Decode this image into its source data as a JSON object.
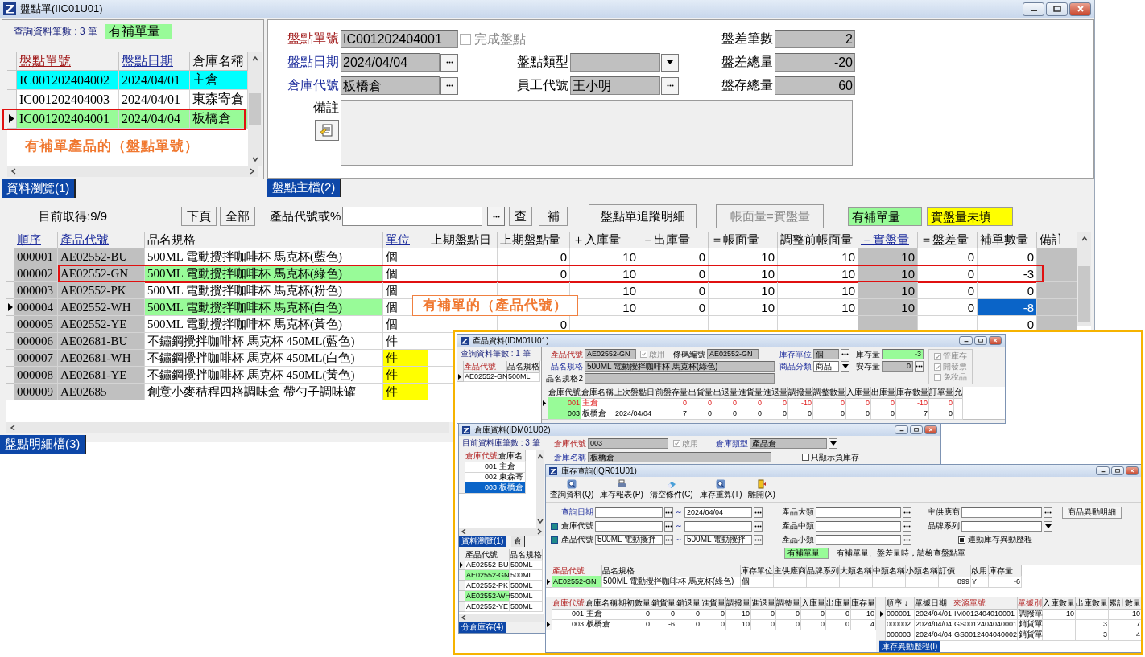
{
  "window": {
    "title": "盤點單(IIC01U01)"
  },
  "browse": {
    "count_text": "查詢資料筆數 : 3 筆",
    "legend": {
      "label": "有補單量",
      "color": "#98fb98"
    },
    "columns": [
      "盤點單號",
      "盤點日期",
      "倉庫名稱"
    ],
    "rows": [
      {
        "cells": [
          "IC001202404002",
          "2024/04/01",
          "主倉"
        ],
        "color": "#00ffff",
        "current": false,
        "annotated": false
      },
      {
        "cells": [
          "IC001202404003",
          "2024/04/01",
          "東森寄倉"
        ],
        "color": "#ffffff",
        "current": false,
        "annotated": false
      },
      {
        "cells": [
          "IC001202404001",
          "2024/04/04",
          "板橋倉"
        ],
        "color": "#98fb98",
        "current": true,
        "annotated": true
      }
    ],
    "annotation": "有補單產品的（盤點單號）",
    "tab": {
      "label": "資料瀏覽(1)",
      "selected": true
    }
  },
  "master": {
    "rows": [
      [
        {
          "kind": "text",
          "label": "盤點單號",
          "value": "IC001202404001"
        },
        {
          "kind": "checkbox",
          "label": "完成盤點",
          "checked": false,
          "disabled": true
        },
        {
          "kind": "number",
          "label": "盤差筆數",
          "value": "2"
        }
      ],
      [
        {
          "kind": "lookup",
          "label": "盤點日期",
          "value": "2024/04/04"
        },
        {
          "kind": "dropdown",
          "label": "盤點類型"
        },
        {
          "kind": "number",
          "label": "盤差總量",
          "value": "-20"
        }
      ],
      [
        {
          "kind": "lookup",
          "label": "倉庫代號",
          "value": "板橋倉"
        },
        {
          "kind": "lookup",
          "label": "員工代號",
          "value": "王小明"
        },
        {
          "kind": "number",
          "label": "盤存總量",
          "value": "60"
        }
      ]
    ],
    "remark_label": "備註",
    "tab": {
      "label": "盤點主檔(2)",
      "selected": true
    }
  },
  "detail": {
    "fetched": "目前取得:9/9",
    "page_buttons": [
      "下頁",
      "全部"
    ],
    "search_label": "產品代號或%",
    "query_button": "查",
    "supplement_button": "補",
    "trace_button": "盤點單追蹤明細",
    "sync_button": {
      "label": "帳面量=實盤量",
      "disabled": true
    },
    "legends": [
      {
        "label": "有補單量",
        "color": "#98fb98"
      },
      {
        "label": "實盤量未填",
        "color": "#ffff00"
      }
    ],
    "columns": [
      "順序",
      "產品代號",
      "品名規格",
      "單位",
      "上期盤點日",
      "上期盤點量",
      "＋入庫量",
      "－出庫量",
      "＝帳面量",
      "調整前帳面量",
      "－實盤量",
      "＝盤差量",
      "補單數量",
      "備註"
    ],
    "rows": [
      {
        "seq": "000001",
        "code": "AE02552-BU",
        "name": "500ML 電動攪拌咖啡杯 馬克杯(藍色)",
        "unit": "個",
        "values": {
          "prev_qty": "0",
          "in_qty": "10",
          "out_qty": "0",
          "book_qty": "10",
          "pre_adjust_qty": "10",
          "counted_qty": "10",
          "diff_qty": "0",
          "supplement_qty": "0"
        },
        "has_supplement": false,
        "count_missing": false,
        "current": false,
        "cell_selected": false,
        "annotated": false
      },
      {
        "seq": "000002",
        "code": "AE02552-GN",
        "name": "500ML 電動攪拌咖啡杯 馬克杯(綠色)",
        "unit": "個",
        "values": {
          "prev_qty": "0",
          "in_qty": "10",
          "out_qty": "0",
          "book_qty": "10",
          "pre_adjust_qty": "10",
          "counted_qty": "10",
          "diff_qty": "0",
          "supplement_qty": "-3"
        },
        "has_supplement": true,
        "count_missing": false,
        "current": false,
        "cell_selected": false,
        "annotated": true
      },
      {
        "seq": "000003",
        "code": "AE02552-PK",
        "name": "500ML 電動攪拌咖啡杯 馬克杯(粉色)",
        "unit": "個",
        "values": {
          "in_qty": "10",
          "out_qty": "0",
          "book_qty": "10",
          "pre_adjust_qty": "10",
          "counted_qty": "10",
          "diff_qty": "0",
          "supplement_qty": "0"
        },
        "has_supplement": false,
        "count_missing": false,
        "current": false,
        "cell_selected": false,
        "annotated": false
      },
      {
        "seq": "000004",
        "code": "AE02552-WH",
        "name": "500ML 電動攪拌咖啡杯 馬克杯(白色)",
        "unit": "個",
        "values": {
          "in_qty": "10",
          "out_qty": "0",
          "book_qty": "10",
          "pre_adjust_qty": "10",
          "counted_qty": "10",
          "diff_qty": "0",
          "supplement_qty": "-8"
        },
        "has_supplement": true,
        "count_missing": false,
        "current": true,
        "cell_selected": true,
        "annotated": false
      },
      {
        "seq": "000005",
        "code": "AE02552-YE",
        "name": "500ML 電動攪拌咖啡杯 馬克杯(黃色)",
        "unit": "個",
        "values": {
          "prev_qty": "0",
          "supplement_qty": "0"
        },
        "has_supplement": false,
        "count_missing": false,
        "current": false,
        "cell_selected": false,
        "annotated": false
      },
      {
        "seq": "000006",
        "code": "AE02681-BU",
        "name": "不鏽鋼攪拌咖啡杯 馬克杯 450ML(藍色)",
        "unit": "件",
        "has_supplement": false,
        "count_missing": false,
        "current": false,
        "annotated": false
      },
      {
        "seq": "000007",
        "code": "AE02681-WH",
        "name": "不鏽鋼攪拌咖啡杯 馬克杯 450ML(白色)",
        "unit": "件",
        "has_supplement": false,
        "count_missing": true,
        "current": false,
        "annotated": false
      },
      {
        "seq": "000008",
        "code": "AE02681-YE",
        "name": "不鏽鋼攪拌咖啡杯 馬克杯 450ML(黃色)",
        "unit": "件",
        "has_supplement": false,
        "count_missing": true,
        "current": false,
        "annotated": false
      },
      {
        "seq": "000009",
        "code": "AE02685",
        "name": "創意小麥秸稈四格調味盒 帶勺子調味罐",
        "unit": "件",
        "has_supplement": false,
        "count_missing": true,
        "current": false,
        "annotated": false
      }
    ],
    "annotation": "有補單的（產品代號）",
    "tab": {
      "label": "盤點明細檔(3)",
      "selected": true
    }
  },
  "inset": {
    "product_window": {
      "title": "產品資料(IDM01U01)",
      "count_text": "查詢資料筆數 : 1 筆",
      "list_columns": [
        {
          "label": "產品代號"
        },
        {
          "label": "品名規格"
        }
      ],
      "list_rows": [
        {
          "cells": {
            "code": "AE02552-GN",
            "name": "500ML"
          },
          "current": true
        }
      ],
      "code": {
        "label": "產品代號",
        "value": "AE02552-GN"
      },
      "enabled": {
        "label": "啟用",
        "checked": true
      },
      "barcode": {
        "label": "條碼編號",
        "value": "AE02552-GN"
      },
      "unit": {
        "label": "庫存單位",
        "value": "個"
      },
      "stock": {
        "label": "庫存量",
        "value": "-3",
        "highlight": true
      },
      "spec": {
        "label": "品名規格",
        "value": "500ML 電動攪拌咖啡杯 馬克杯(綠色)"
      },
      "category": {
        "label": "商品分類",
        "value": "商品"
      },
      "safety": {
        "label": "安存量",
        "value": "0"
      },
      "spec2": {
        "label": "品名規格2"
      },
      "flags": [
        {
          "label": "管庫存",
          "checked": true
        },
        {
          "label": "開發票",
          "checked": true
        },
        {
          "label": "免稅品",
          "checked": false
        }
      ],
      "grid_columns": [
        {
          "label": "倉庫代號"
        },
        {
          "label": "倉庫名稱"
        },
        {
          "label": "上次盤點日"
        },
        {
          "label": "前盤存量"
        },
        {
          "label": "出貨量"
        },
        {
          "label": "出退量"
        },
        {
          "label": "進貨量"
        },
        {
          "label": "進退量"
        },
        {
          "label": "調撥量"
        },
        {
          "label": "調整數量"
        },
        {
          "label": "入庫量"
        },
        {
          "label": "出庫量"
        },
        {
          "label": "庫存數量"
        },
        {
          "label": "訂單量"
        },
        {
          "label": "允"
        }
      ],
      "grid_rows": [
        {
          "cells": {
            "code": "001",
            "name": "主倉",
            "prev_stock": "0",
            "sales": "0",
            "sales_return": "0",
            "purchase": "0",
            "purchase_return": "0",
            "transfer": "-10",
            "adjust": "0",
            "stock_in": "0",
            "stock_out": "0",
            "stock": "-10",
            "orders": "0"
          },
          "alert": true,
          "current": true
        },
        {
          "cells": {
            "code": "003",
            "name": "板橋倉",
            "last_count_date": "2024/04/04",
            "prev_stock": "7",
            "sales": "0",
            "sales_return": "0",
            "purchase": "0",
            "purchase_return": "0",
            "transfer": "0",
            "adjust": "0",
            "stock_in": "0",
            "stock_out": "0",
            "stock": "7",
            "orders": "0"
          },
          "alert": false,
          "current": false
        }
      ]
    },
    "warehouse_window": {
      "title": "倉庫資料(IDM01U02)",
      "count_text": "目前資料庫筆數 : 3 筆",
      "list_columns": [
        {
          "label": "倉庫代號"
        },
        {
          "label": "倉庫名"
        }
      ],
      "list_rows": [
        {
          "cells": {
            "code": "001",
            "name": "主倉"
          },
          "selected": false
        },
        {
          "cells": {
            "code": "002",
            "name": "東森寄"
          },
          "selected": false
        },
        {
          "cells": {
            "code": "003",
            "name": "板橋倉"
          },
          "selected": true
        }
      ],
      "tabs": [
        {
          "label": "資料瀏覽(1)",
          "selected": true
        },
        {
          "label": "倉",
          "selected": false
        }
      ],
      "code": {
        "label": "倉庫代號",
        "value": "003"
      },
      "enabled": {
        "label": "啟用",
        "checked": true
      },
      "type": {
        "label": "倉庫類型",
        "value": "產品倉"
      },
      "name": {
        "label": "倉庫名稱",
        "value": "板橋倉"
      },
      "negative_only": {
        "label": "只顯示負庫存",
        "checked": false
      },
      "stock_columns": [
        {
          "label": "產品代號"
        },
        {
          "label": "品名規格"
        }
      ],
      "stock_rows": [
        {
          "cells": {
            "code": "AE02552-BU",
            "spec": "500ML"
          },
          "highlight": false,
          "current": true
        },
        {
          "cells": {
            "code": "AE02552-GN",
            "spec": "500ML"
          },
          "highlight": true,
          "current": false
        },
        {
          "cells": {
            "code": "AE02552-PK",
            "spec": "500ML"
          },
          "highlight": false,
          "current": false
        },
        {
          "cells": {
            "code": "AE02552-WH",
            "spec": "500ML"
          },
          "highlight": true,
          "current": false
        },
        {
          "cells": {
            "code": "AE02552-YE",
            "spec": "500ML"
          },
          "highlight": false,
          "current": false
        }
      ],
      "stock_tab": {
        "label": "分倉庫存(4)",
        "selected": true
      }
    },
    "stock_window": {
      "title": "庫存查詢(IQR01U01)",
      "toolbar": [
        {
          "label": "查詢資料(Q)",
          "kind": "query"
        },
        {
          "label": "庫存報表(P)",
          "kind": "print"
        },
        {
          "label": "清空條件(C)",
          "kind": "clear"
        },
        {
          "label": "庫存重算(T)",
          "kind": "recalc"
        },
        {
          "label": "離開(X)",
          "kind": "exit"
        }
      ],
      "ranges": [
        {
          "label": "查詢日期",
          "to": "2024/04/04",
          "separator": "～"
        },
        {
          "label": "倉庫代號",
          "marker": true,
          "separator": "～"
        },
        {
          "label": "產品代號",
          "marker": true,
          "from": "500ML 電動攪拌",
          "to": "500ML 電動攪拌",
          "separator": "～"
        }
      ],
      "categories": [
        {
          "label": "產品大類"
        },
        {
          "label": "產品中類"
        },
        {
          "label": "產品小類"
        }
      ],
      "supplier": {
        "label": "主供應商"
      },
      "brand": {
        "label": "品牌系列"
      },
      "detail_button": "商品異動明細",
      "linked": {
        "label": "連動庫存異動歷程",
        "checked": true
      },
      "legend": {
        "label": "有補單量",
        "color": "#98fb98"
      },
      "hint": "有補單量、盤差量時，請檢查盤點單",
      "product_columns": [
        {
          "label": "產品代號"
        },
        {
          "label": "品名規格"
        },
        {
          "label": "庫存單位"
        },
        {
          "label": "主供應商"
        },
        {
          "label": "品牌系列"
        },
        {
          "label": "大類名稱"
        },
        {
          "label": "中類名稱"
        },
        {
          "label": "小類名稱"
        },
        {
          "label": "訂價"
        },
        {
          "label": "啟用"
        },
        {
          "label": "庫存量"
        }
      ],
      "product_rows": [
        {
          "cells": {
            "code": "AE02552-GN",
            "spec": "500ML 電動攪拌咖啡杯 馬克杯(綠色)",
            "unit": "個",
            "price": "899",
            "enabled": "Y",
            "stock": "-6"
          },
          "highlight": true,
          "current": true
        }
      ],
      "warehouse_columns": [
        {
          "label": "倉庫代號"
        },
        {
          "label": "倉庫名稱"
        },
        {
          "label": "期初數量"
        },
        {
          "label": "銷貨量"
        },
        {
          "label": "銷退量"
        },
        {
          "label": "進貨量"
        },
        {
          "label": "調撥量"
        },
        {
          "label": "進退量"
        },
        {
          "label": "調整量"
        },
        {
          "label": "入庫量"
        },
        {
          "label": "出庫量"
        },
        {
          "label": "庫存量"
        }
      ],
      "warehouse_rows": [
        {
          "cells": {
            "code": "001",
            "name": "主倉",
            "opening": "0",
            "sales": "0",
            "sales_return": "0",
            "purchase": "0",
            "transfer": "-10",
            "purchase_return": "0",
            "adjust": "0",
            "stock_in": "0",
            "stock_out": "0",
            "stock": "-10"
          },
          "current": false
        },
        {
          "cells": {
            "code": "003",
            "name": "板橋倉",
            "opening": "0",
            "sales": "-6",
            "sales_return": "0",
            "purchase": "0",
            "transfer": "10",
            "purchase_return": "0",
            "adjust": "0",
            "stock_in": "0",
            "stock_out": "0",
            "stock": "4"
          },
          "current": true
        }
      ],
      "history_columns": [
        {
          "label": "順序 ↓"
        },
        {
          "label": "單據日期"
        },
        {
          "label": "來源單號"
        },
        {
          "label": "單據別"
        },
        {
          "label": "入庫數量"
        },
        {
          "label": "出庫數量"
        },
        {
          "label": "累計數量"
        }
      ],
      "history_rows": [
        {
          "cells": {
            "seq": "000001",
            "date": "2024/04/01",
            "source": "IM0012404010001",
            "type": "調撥單",
            "in_qty": "10",
            "balance": "10"
          },
          "current": true
        },
        {
          "cells": {
            "seq": "000002",
            "date": "2024/04/04",
            "source": "GS0012404040001",
            "type": "銷貨單",
            "out_qty": "3",
            "balance": "7"
          },
          "current": false
        },
        {
          "cells": {
            "seq": "000003",
            "date": "2024/04/04",
            "source": "GS0012404040002",
            "type": "銷貨單",
            "out_qty": "3",
            "balance": "4"
          },
          "current": false
        }
      ],
      "history_tab": {
        "label": "庫存異動歷程(I)",
        "selected": true
      }
    }
  }
}
